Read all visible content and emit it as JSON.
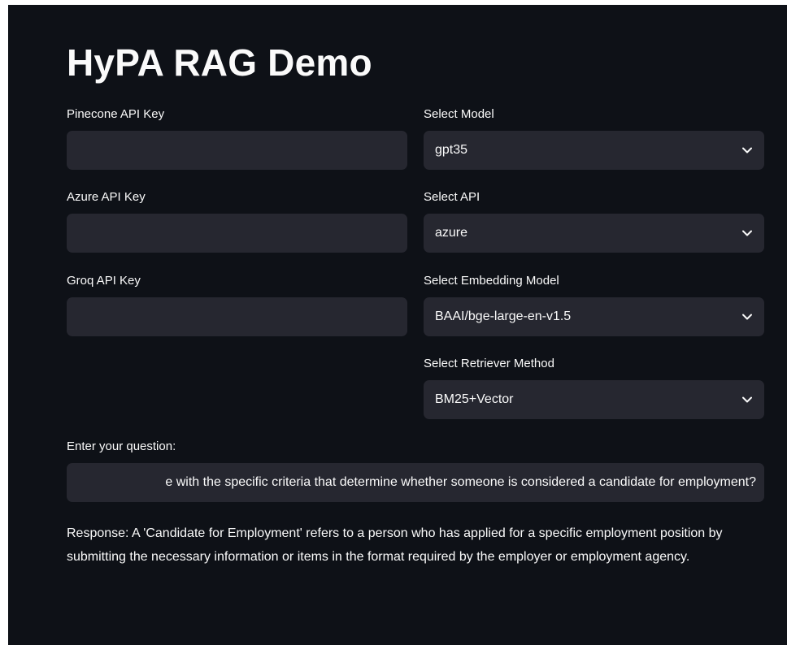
{
  "app": {
    "title": "HyPA RAG Demo"
  },
  "inputs": {
    "pinecone_label": "Pinecone API Key",
    "pinecone_value": "",
    "azure_label": "Azure API Key",
    "azure_value": "",
    "groq_label": "Groq API Key",
    "groq_value": ""
  },
  "selects": {
    "model_label": "Select Model",
    "model_value": "gpt35",
    "api_label": "Select API",
    "api_value": "azure",
    "embedding_label": "Select Embedding Model",
    "embedding_value": "BAAI/bge-large-en-v1.5",
    "retriever_label": "Select Retriever Method",
    "retriever_value": "BM25+Vector",
    "chevron_icon": "chevron-down-icon"
  },
  "question": {
    "label": "Enter your question:",
    "value": "e with the specific criteria that determine whether someone is considered a candidate for employment?"
  },
  "response": {
    "text": "Response: A 'Candidate for Employment' refers to a person who has applied for a specific employment position by submitting the necessary information or items in the format required by the employer or employment agency."
  },
  "colors": {
    "background": "#0e1117",
    "input_background": "#262730",
    "text": "#fafafa"
  }
}
